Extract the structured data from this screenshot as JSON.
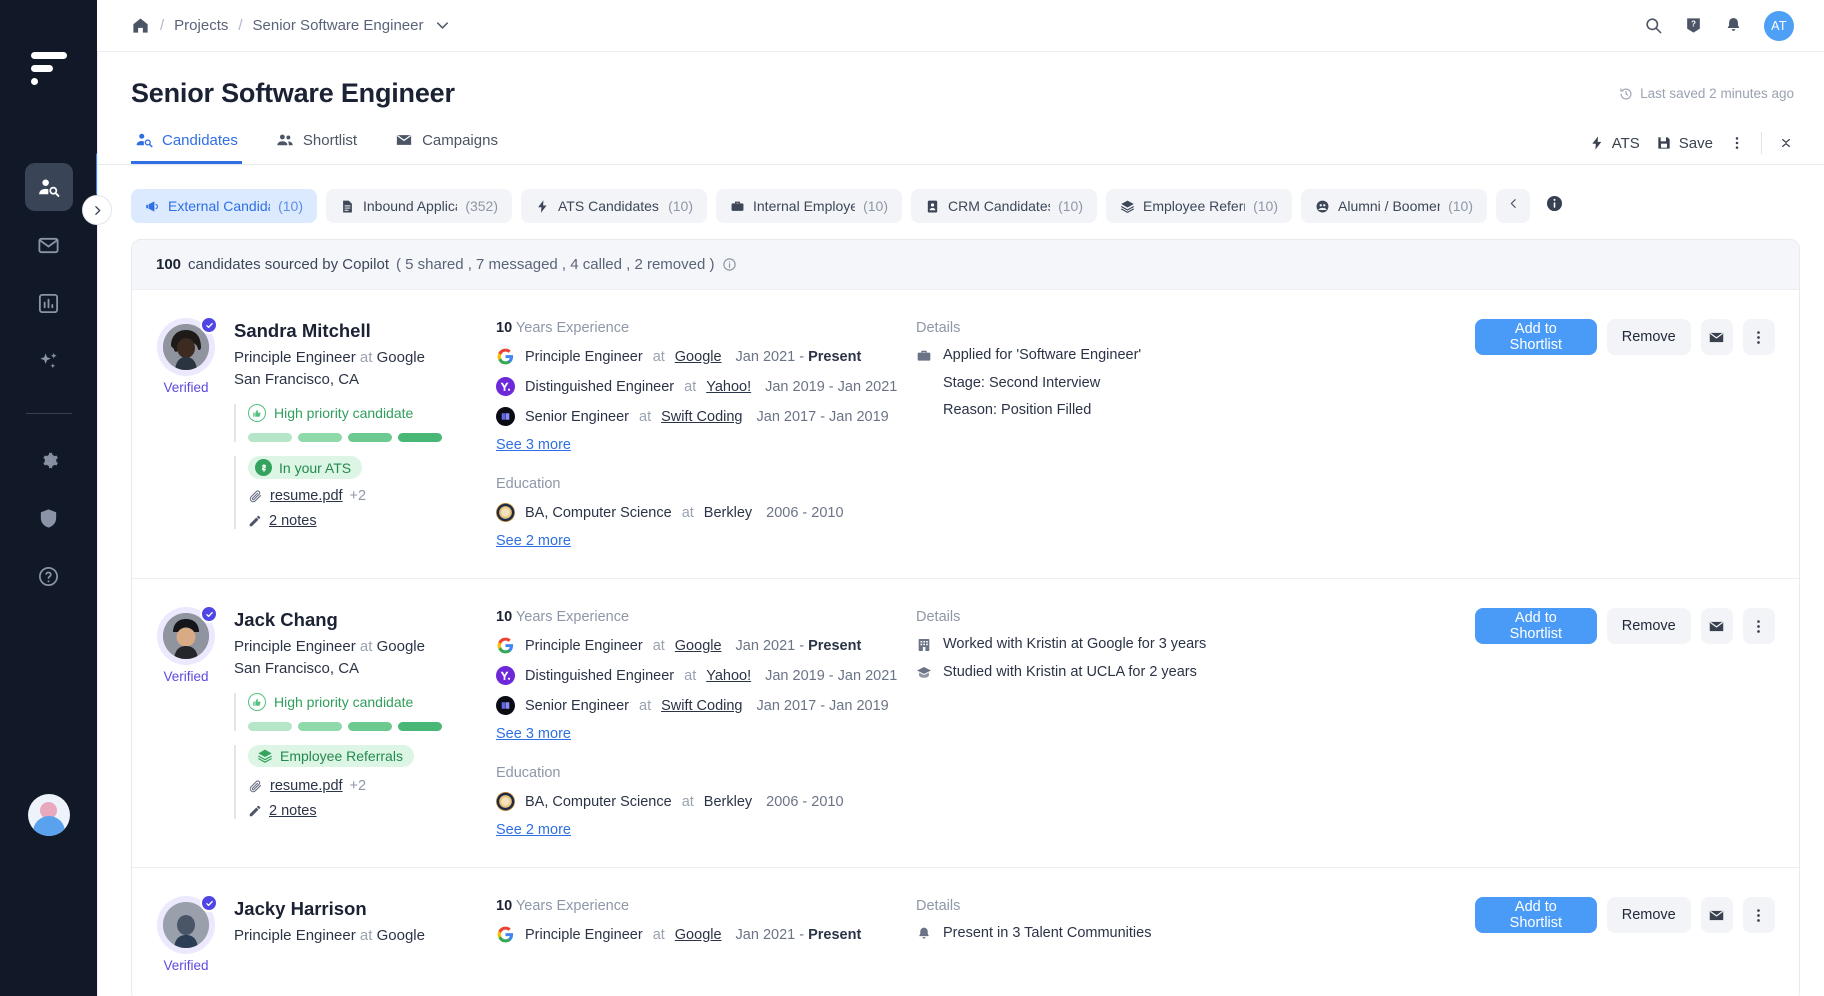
{
  "sidebar": {
    "logo_name": "app-logo",
    "items": [
      {
        "name": "candidate-search",
        "icon": "person-search-icon",
        "active": true
      },
      {
        "name": "inbox",
        "icon": "envelope-icon",
        "active": false
      },
      {
        "name": "analytics",
        "icon": "bar-chart-icon",
        "active": false
      },
      {
        "name": "copilot",
        "icon": "sparkles-icon",
        "active": false
      },
      {
        "name": "settings",
        "icon": "gear-icon",
        "active": false
      },
      {
        "name": "security",
        "icon": "shield-icon",
        "active": false
      },
      {
        "name": "help",
        "icon": "question-circle-icon",
        "active": false
      }
    ]
  },
  "topbar": {
    "home_icon": "home-icon",
    "separator": "/",
    "breadcrumbs": [
      "Projects",
      "Senior Software Engineer"
    ],
    "chevron_icon": "chevron-down-icon",
    "search_icon": "search-icon",
    "help_icon": "help-badge-icon",
    "bell_icon": "bell-icon",
    "avatar_initials": "AT",
    "avatar_color": "#4da0f5"
  },
  "header": {
    "title": "Senior Software Engineer",
    "last_saved": "Last saved 2 minutes ago",
    "clock_icon": "history-icon"
  },
  "tabs": [
    {
      "label": "Candidates",
      "icon": "person-search-icon",
      "active": true
    },
    {
      "label": "Shortlist",
      "icon": "people-icon",
      "active": false
    },
    {
      "label": "Campaigns",
      "icon": "envelope-icon",
      "active": false
    }
  ],
  "tab_actions": {
    "ats_label": "ATS",
    "ats_icon": "bolt-icon",
    "save_label": "Save",
    "save_icon": "floppy-disk-icon",
    "more_icon": "more-vertical-icon",
    "collapse_icon": "collapse-icon"
  },
  "chips": [
    {
      "label": "External Candidates",
      "count": "(10)",
      "icon": "megaphone-icon",
      "active": true
    },
    {
      "label": "Inbound Applicants",
      "count": "(352)",
      "icon": "document-icon",
      "active": false
    },
    {
      "label": "ATS Candidates",
      "count": "(10)",
      "icon": "bolt-icon",
      "active": false
    },
    {
      "label": "Internal Employees",
      "count": "(10)",
      "icon": "briefcase-icon",
      "active": false
    },
    {
      "label": "CRM Candidates",
      "count": "(10)",
      "icon": "id-card-icon",
      "active": false
    },
    {
      "label": "Employee Referrals",
      "count": "(10)",
      "icon": "layers-icon",
      "active": false
    },
    {
      "label": "Alumni / Boomerangs",
      "count": "(10)",
      "icon": "people-circle-icon",
      "active": false
    }
  ],
  "chip_nav": {
    "prev_icon": "chevron-left-icon",
    "info_icon": "info-filled-icon"
  },
  "expand_icon": "chevron-right-icon",
  "summary": {
    "count": "100",
    "text": "candidates sourced by Copilot",
    "detail": "( 5 shared , 7 messaged , 4 called , 2 removed )",
    "info_icon": "info-icon"
  },
  "colors": {
    "accent_blue": "#2f6fe4",
    "primary_button": "#4a9bf7",
    "verified_purple": "#5b4ae0",
    "green": "#2f9e5c",
    "sidebar_bg": "#111827"
  },
  "section_labels": {
    "experience_suffix": "Years Experience",
    "education": "Education",
    "details": "Details"
  },
  "actions": {
    "add_to_shortlist": "Add to Shortlist",
    "remove": "Remove",
    "email_icon": "envelope-icon",
    "more_icon": "more-vertical-icon"
  },
  "candidates": [
    {
      "name": "Sandra Mitchell",
      "role": "Principle Engineer",
      "at": "at",
      "company": "Google",
      "location": "San Francisco, CA",
      "verified_label": "Verified",
      "verified_icon": "check-badge-icon",
      "avatar": "woman-avatar",
      "priority_label": "High priority candidate",
      "priority_icon": "thumbs-up-icon",
      "priority_bars": 4,
      "tag": {
        "label": "In your ATS",
        "icon": "ats-dollar-icon",
        "style": "ats"
      },
      "file": {
        "name": "resume.pdf",
        "extra": "+2",
        "icon": "paperclip-icon"
      },
      "notes": {
        "label": "2 notes",
        "icon": "pencil-icon"
      },
      "years": "10",
      "experience": [
        {
          "title": "Principle Engineer",
          "at": "at",
          "company": "Google",
          "dates_from": "Jan 2021 - ",
          "dates_to": "Present",
          "to_bold": true,
          "logo": "google-logo"
        },
        {
          "title": "Distinguished Engineer",
          "at": "at",
          "company": "Yahoo!",
          "dates_from": "Jan 2019 - Jan 2021",
          "dates_to": "",
          "to_bold": false,
          "logo": "yahoo-logo"
        },
        {
          "title": "Senior Engineer",
          "at": "at",
          "company": "Swift Coding",
          "dates_from": "Jan 2017 - Jan 2019",
          "dates_to": "",
          "to_bold": false,
          "logo": "swift-logo"
        }
      ],
      "exp_see_more": "See 3 more",
      "education": [
        {
          "degree": "BA, Computer Science",
          "at": "at",
          "school": "Berkley",
          "dates": "2006 - 2010",
          "logo": "berkley-logo"
        }
      ],
      "edu_see_more": "See 2 more",
      "details": [
        {
          "text": "Applied for 'Software Engineer'",
          "icon": "briefcase-icon",
          "indent": false
        },
        {
          "text": "Stage: Second Interview",
          "icon": "",
          "indent": true
        },
        {
          "text": "Reason: Position Filled",
          "icon": "",
          "indent": true
        }
      ]
    },
    {
      "name": "Jack Chang",
      "role": "Principle Engineer",
      "at": "at",
      "company": "Google",
      "location": "San Francisco, CA",
      "verified_label": "Verified",
      "verified_icon": "check-badge-icon",
      "avatar": "man-avatar",
      "priority_label": "High priority candidate",
      "priority_icon": "thumbs-up-icon",
      "priority_bars": 4,
      "tag": {
        "label": "Employee Referrals",
        "icon": "layers-icon",
        "style": "referral"
      },
      "file": {
        "name": "resume.pdf",
        "extra": "+2",
        "icon": "paperclip-icon"
      },
      "notes": {
        "label": "2 notes",
        "icon": "pencil-icon"
      },
      "years": "10",
      "experience": [
        {
          "title": "Principle Engineer",
          "at": "at",
          "company": "Google",
          "dates_from": "Jan 2021 - ",
          "dates_to": "Present",
          "to_bold": true,
          "logo": "google-logo"
        },
        {
          "title": "Distinguished Engineer",
          "at": "at",
          "company": "Yahoo!",
          "dates_from": "Jan 2019 - Jan 2021",
          "dates_to": "",
          "to_bold": false,
          "logo": "yahoo-logo"
        },
        {
          "title": "Senior Engineer",
          "at": "at",
          "company": "Swift Coding",
          "dates_from": "Jan 2017 - Jan 2019",
          "dates_to": "",
          "to_bold": false,
          "logo": "swift-logo"
        }
      ],
      "exp_see_more": "See 3 more",
      "education": [
        {
          "degree": "BA, Computer Science",
          "at": "at",
          "school": "Berkley",
          "dates": "2006 - 2010",
          "logo": "berkley-logo"
        }
      ],
      "edu_see_more": "See 2 more",
      "details": [
        {
          "text": "Worked with Kristin at Google for 3 years",
          "icon": "building-icon",
          "indent": false
        },
        {
          "text": "Studied with Kristin at UCLA for 2 years",
          "icon": "graduation-cap-icon",
          "indent": false
        }
      ]
    },
    {
      "name": "Jacky Harrison",
      "role": "Principle Engineer",
      "at": "at",
      "company": "Google",
      "location": "",
      "verified_label": "Verified",
      "verified_icon": "check-badge-icon",
      "avatar": "person-avatar",
      "priority_label": "",
      "priority_icon": "",
      "priority_bars": 0,
      "years": "10",
      "experience": [
        {
          "title": "Principle Engineer",
          "at": "at",
          "company": "Google",
          "dates_from": "Jan 2021 - ",
          "dates_to": "Present",
          "to_bold": true,
          "logo": "google-logo"
        }
      ],
      "exp_see_more": "",
      "education": [],
      "edu_see_more": "",
      "details": [
        {
          "text": "Present in 3 Talent Communities",
          "icon": "bell-icon",
          "indent": false
        }
      ]
    }
  ]
}
